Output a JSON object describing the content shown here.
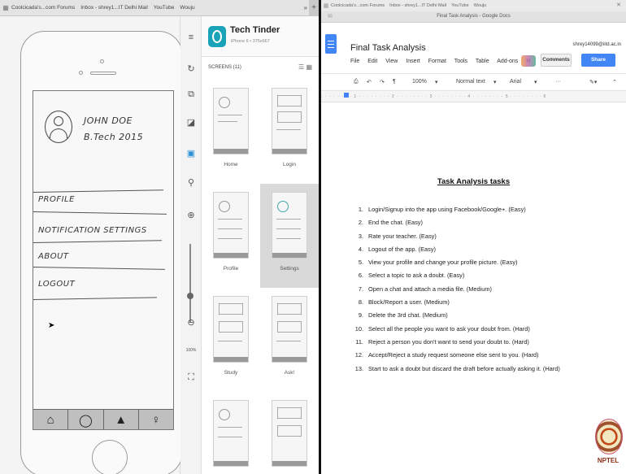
{
  "left_window": {
    "bookmarks": [
      "Coolcicada's...com Forums",
      "Inbox - shrey1...IT Delhi Mail",
      "YouTube",
      "Wouju"
    ],
    "overflow": "»",
    "new_tab": "+",
    "phone_screen": {
      "name": "JOHN DOE",
      "degree": "B.Tech 2015",
      "menu": [
        "PROFILE",
        "NOTIFICATION SETTINGS",
        "ABOUT",
        "LOGOUT"
      ],
      "tab_icons": [
        "home-icon",
        "chat-icon",
        "bell-icon",
        "person-icon"
      ]
    },
    "toolbar_icons": [
      "menu-icon",
      "refresh-icon",
      "copy-icon",
      "crop-icon",
      "select-icon",
      "pin-icon",
      "zoom-in-icon",
      "zoom-out-icon",
      "fullscreen-icon"
    ],
    "zoom_level": "100%",
    "app": {
      "title": "Tech Tinder",
      "subtitle": "iPhone 6 • 375x667",
      "screens_label": "SCREENS (11)",
      "screens": [
        "Home",
        "Login",
        "Profile",
        "Settings",
        "Study",
        "Ask!",
        "",
        ""
      ],
      "selected_screen": "Settings"
    }
  },
  "right_window": {
    "bookmarks": [
      "Coolcicada's...com Forums",
      "Inbox - shrey1...IT Delhi Mail",
      "YouTube",
      "Wouju"
    ],
    "tab_title": "Final Task Analysis - Google Docs",
    "doc_title": "Final Task Analysis",
    "user": "shrey14099@iitd.ac.in",
    "menu": [
      "File",
      "Edit",
      "View",
      "Insert",
      "Format",
      "Tools",
      "Table",
      "Add-ons",
      "H"
    ],
    "comments_label": "Comments",
    "share_label": "Share",
    "format_bar": {
      "zoom": "100%",
      "style": "Normal text",
      "font": "Arial",
      "more": "···"
    },
    "heading": "Task Analysis tasks",
    "tasks": [
      "Login/Signup into the app using Facebook/Google+. (Easy)",
      "End the chat. (Easy)",
      "Rate your teacher. (Easy)",
      "Logout of the app. (Easy)",
      "View your profile and change your profile picture. (Easy)",
      "Select a topic to ask a doubt. (Easy)",
      "Open a chat and attach a media file. (Medium)",
      "Block/Report a user. (Medium)",
      "Delete the 3rd chat. (Medium)",
      "Select all the people you want to ask your doubt from. (Hard)",
      "Reject a person you don't want to send your doubt to. (Hard)",
      "Accept/Reject a study request someone else sent to you. (Hard)",
      "Start to ask a doubt but discard the draft before actually asking it. (Hard)"
    ]
  },
  "watermark": "NPTEL",
  "colors": {
    "docs_blue": "#4285f4",
    "tinder_teal": "#1aa3b8",
    "selected_thumb": "#d9d9d9"
  }
}
